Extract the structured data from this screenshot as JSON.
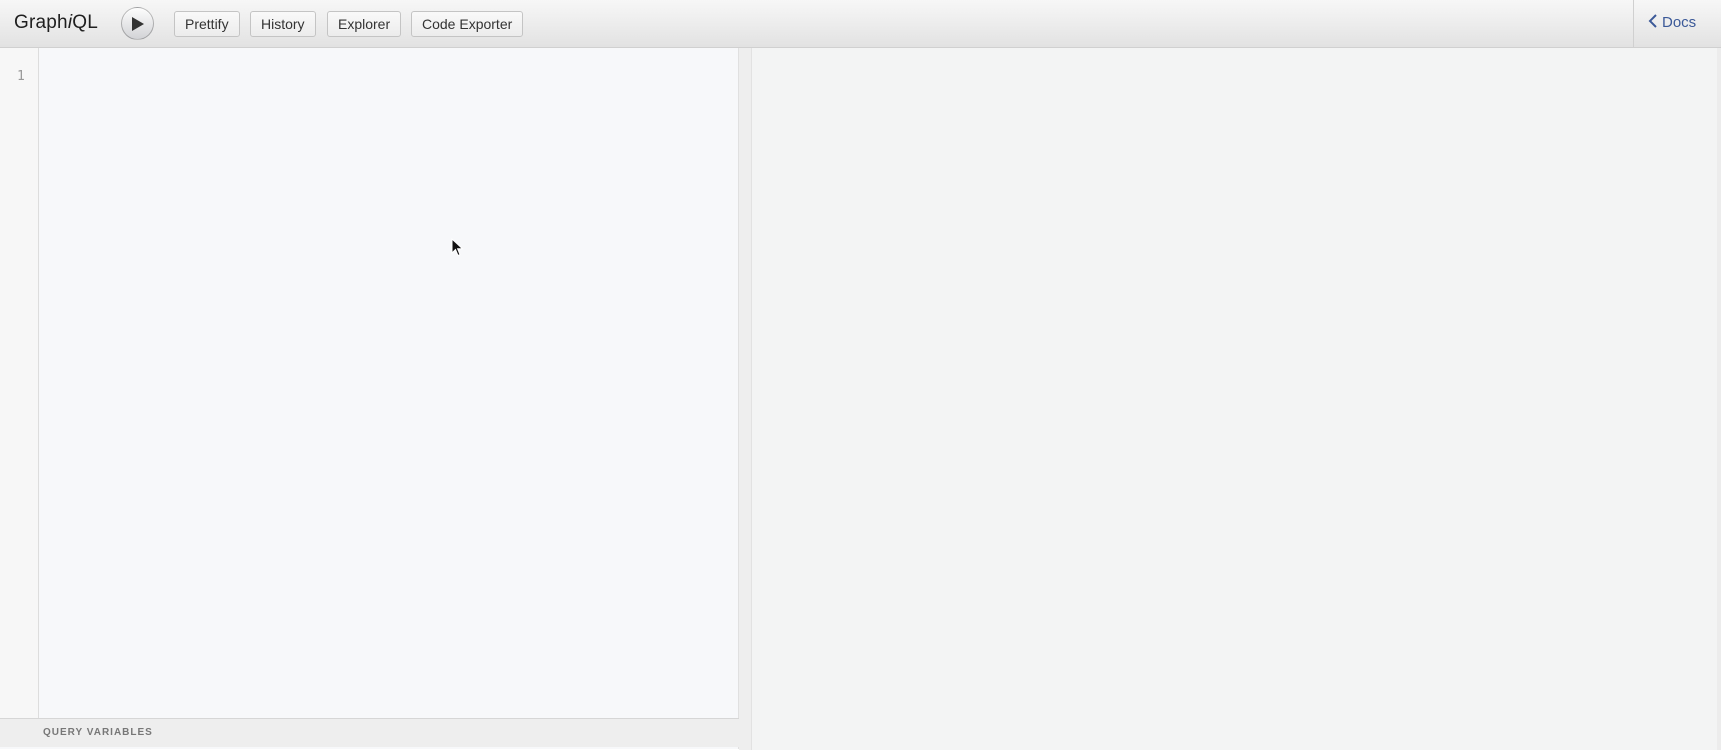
{
  "app": {
    "title_prefix": "Graph",
    "title_italic": "i",
    "title_suffix": "QL"
  },
  "toolbar": {
    "run_icon": "play-icon",
    "buttons": [
      {
        "label": "Prettify"
      },
      {
        "label": "History"
      },
      {
        "label": "Explorer"
      },
      {
        "label": "Code Exporter"
      }
    ],
    "docs_label": "Docs",
    "docs_icon": "chevron-left-icon"
  },
  "editor": {
    "line_numbers": [
      "1"
    ],
    "query_text": ""
  },
  "variables": {
    "header_label": "QUERY VARIABLES"
  },
  "result": {
    "text": ""
  },
  "colors": {
    "docs_link": "#3b5998",
    "editor_bg": "#f7f8fa",
    "result_bg": "#f3f4f4"
  }
}
